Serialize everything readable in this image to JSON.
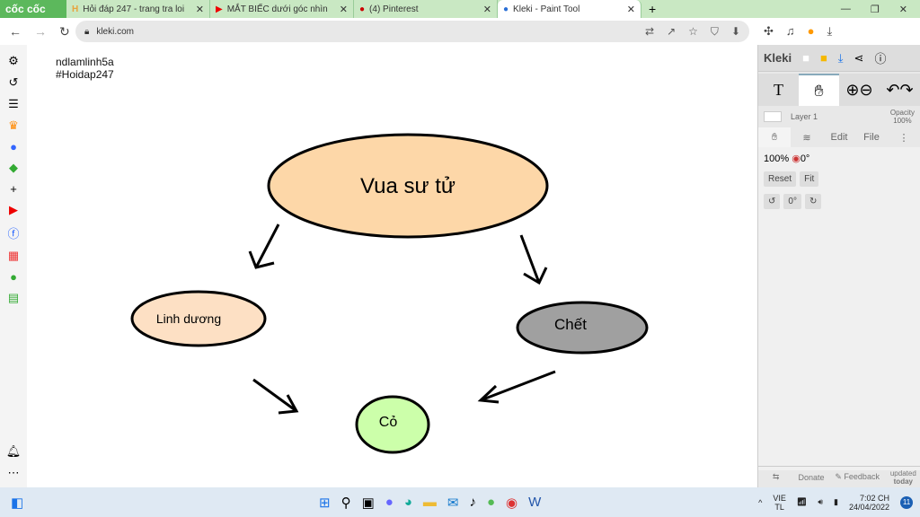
{
  "browser": {
    "brand": "cốc cốc",
    "tabs": [
      {
        "label": "Hỏi đáp 247 - trang tra loi"
      },
      {
        "label": "MẮT BIẾC dưới góc nhìn"
      },
      {
        "label": "(4) Pinterest"
      },
      {
        "label": "Kleki - Paint Tool",
        "active": true
      }
    ],
    "url": "kleki.com"
  },
  "canvas": {
    "watermark": [
      "ndlamlinh5a",
      "#Hoidap247"
    ],
    "nodes": [
      {
        "label": "Vua sư tử",
        "fill": "#fdd7a8"
      },
      {
        "label": "Linh dương",
        "fill": "#fde0c4"
      },
      {
        "label": "Chết",
        "fill": "#a0a0a0"
      },
      {
        "label": "Cỏ",
        "fill": "#ccffaa"
      }
    ]
  },
  "kleki": {
    "logo": "Kleki",
    "layer": "Layer 1",
    "opacity_label": "Opacity",
    "opacity": "100%",
    "tabs": [
      "Edit",
      "File"
    ],
    "zoom": "100%",
    "angle": "0°",
    "reset": "Reset",
    "fit": "Fit",
    "rotate_value": "0°",
    "donate": "Donate",
    "feedback": "Feedback",
    "updated": "updated",
    "today": "today"
  },
  "taskbar": {
    "lang1": "VIE",
    "lang2": "TL",
    "time": "7:02 CH",
    "date": "24/04/2022",
    "notifications": "11"
  }
}
